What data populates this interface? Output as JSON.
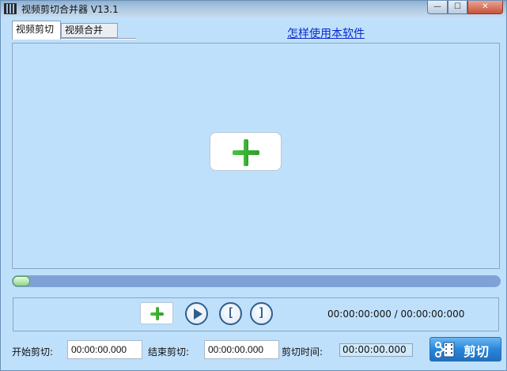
{
  "window": {
    "title": "视频剪切合并器 V13.1",
    "min_glyph": "—",
    "max_glyph": "☐",
    "close_glyph": "✕"
  },
  "tabs": [
    {
      "label": "视频剪切",
      "active": true
    },
    {
      "label": "视频合并",
      "active": false
    }
  ],
  "help_link": "怎样使用本软件",
  "player": {
    "time_readout": "00:00:00:000 / 00:00:00:000",
    "progress": 0
  },
  "cut": {
    "start_label": "开始剪切:",
    "start_value": "00:00:00.000",
    "end_label": "结束剪切:",
    "end_value": "00:00:00.000",
    "duration_label": "剪切时间:",
    "duration_value": "00:00:00.000",
    "button_label": "剪切"
  },
  "icons": {
    "add_video": "plus-icon",
    "play": "play-icon",
    "mark_in": "bracket-left-icon",
    "mark_out": "bracket-right-icon",
    "cut": "scissors-film-icon"
  },
  "colors": {
    "background": "#bfe0fb",
    "accent": "#2a86d8",
    "plus": "#3cb637",
    "link": "#0a2ad0"
  }
}
